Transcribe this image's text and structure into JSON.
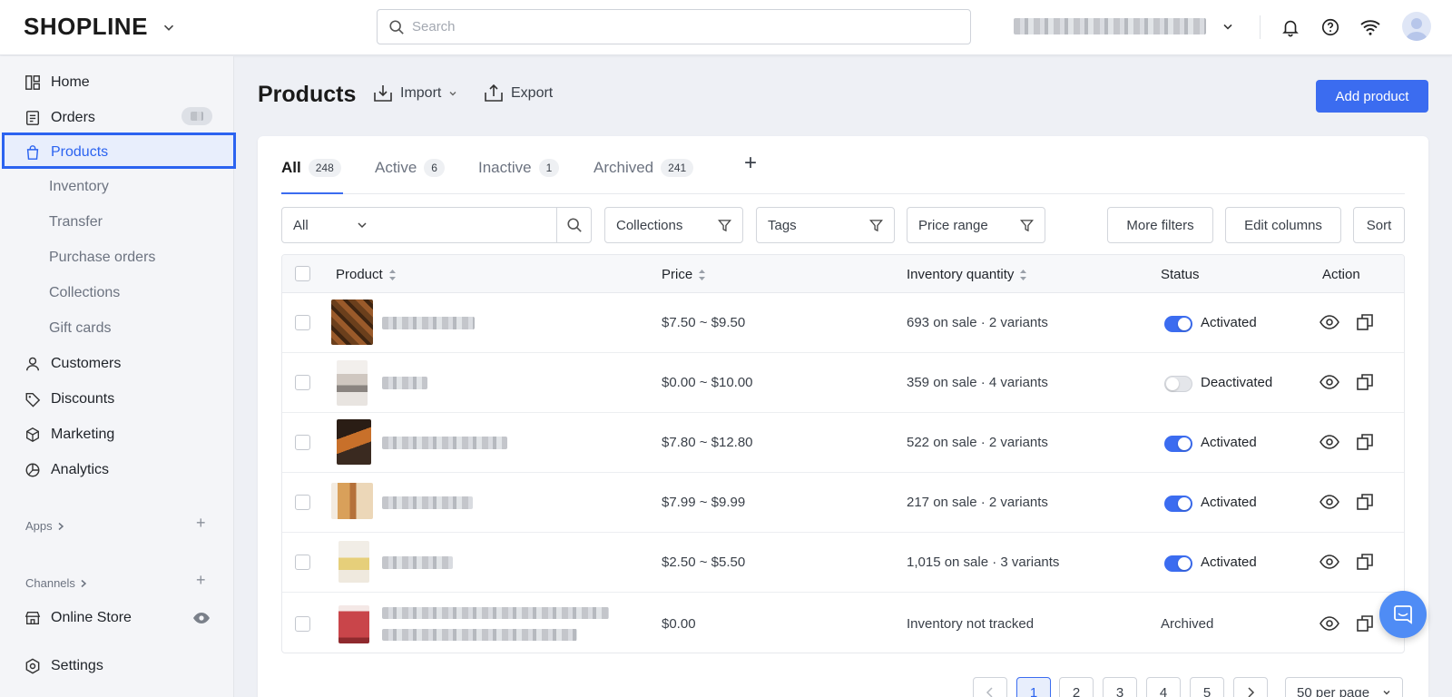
{
  "brand": {
    "name": "SHOPLINE"
  },
  "search": {
    "placeholder": "Search"
  },
  "sidebar": {
    "items": [
      {
        "label": "Home",
        "icon": "dashboard-icon"
      },
      {
        "label": "Orders",
        "icon": "orders-icon"
      },
      {
        "label": "Products",
        "icon": "bag-icon"
      },
      {
        "label": "Inventory"
      },
      {
        "label": "Transfer"
      },
      {
        "label": "Purchase orders"
      },
      {
        "label": "Collections"
      },
      {
        "label": "Gift cards"
      },
      {
        "label": "Customers",
        "icon": "user-icon"
      },
      {
        "label": "Discounts",
        "icon": "tag-icon"
      },
      {
        "label": "Marketing",
        "icon": "cube-icon"
      },
      {
        "label": "Analytics",
        "icon": "pie-chart-icon"
      }
    ],
    "apps_label": "Apps",
    "channels_label": "Channels",
    "online_store": "Online Store",
    "settings": "Settings"
  },
  "header": {
    "title": "Products",
    "import_label": "Import",
    "export_label": "Export",
    "add_label": "Add product"
  },
  "tabs": [
    {
      "label": "All",
      "count": "248"
    },
    {
      "label": "Active",
      "count": "6"
    },
    {
      "label": "Inactive",
      "count": "1"
    },
    {
      "label": "Archived",
      "count": "241"
    }
  ],
  "filters": {
    "scope": "All",
    "collections": "Collections",
    "tags": "Tags",
    "price_range": "Price range",
    "more_filters": "More filters",
    "edit_columns": "Edit columns",
    "sort": "Sort"
  },
  "table": {
    "columns": [
      "Product",
      "Price",
      "Inventory quantity",
      "Status",
      "Action"
    ],
    "rows": [
      {
        "price": "$7.50 ~ $9.50",
        "inventory": "693 on sale · 2 variants",
        "status": "Activated",
        "active": true
      },
      {
        "price": "$0.00 ~ $10.00",
        "inventory": "359 on sale · 4 variants",
        "status": "Deactivated",
        "active": false
      },
      {
        "price": "$7.80 ~ $12.80",
        "inventory": "522 on sale · 2 variants",
        "status": "Activated",
        "active": true
      },
      {
        "price": "$7.99 ~ $9.99",
        "inventory": "217 on sale · 2 variants",
        "status": "Activated",
        "active": true
      },
      {
        "price": "$2.50 ~ $5.50",
        "inventory": "1,015 on sale · 3 variants",
        "status": "Activated",
        "active": true
      },
      {
        "price": "$0.00",
        "inventory": "Inventory not tracked",
        "status": "Archived",
        "active": null
      }
    ]
  },
  "pagination": {
    "pages": [
      "1",
      "2",
      "3",
      "4",
      "5"
    ],
    "current": "1",
    "per_page": "50 per page"
  },
  "colors": {
    "accent": "#3b6cf0",
    "sidebar_bg": "#f4f5f8",
    "page_bg": "#eef0f5"
  }
}
